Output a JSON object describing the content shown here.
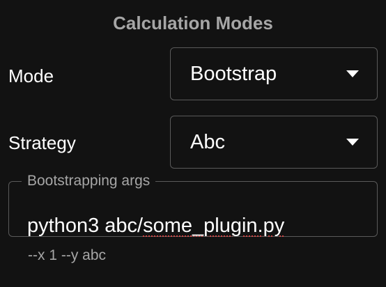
{
  "panel": {
    "title": "Calculation Modes"
  },
  "mode": {
    "label": "Mode",
    "selected": "Bootstrap"
  },
  "strategy": {
    "label": "Strategy",
    "selected": "Abc"
  },
  "bootstrap_args": {
    "label": "Bootstrapping args",
    "value_prefix": "python3 abc/",
    "value_misspelled": "some_plugin.py",
    "helper_text": "--x 1 --y abc"
  },
  "icons": {
    "dropdown": "caret-down-icon"
  },
  "colors": {
    "background": "#121212",
    "text": "#ffffff",
    "muted_text": "#a6a6a6",
    "border": "#5a5a5a",
    "spellcheck_underline": "#d04545"
  }
}
